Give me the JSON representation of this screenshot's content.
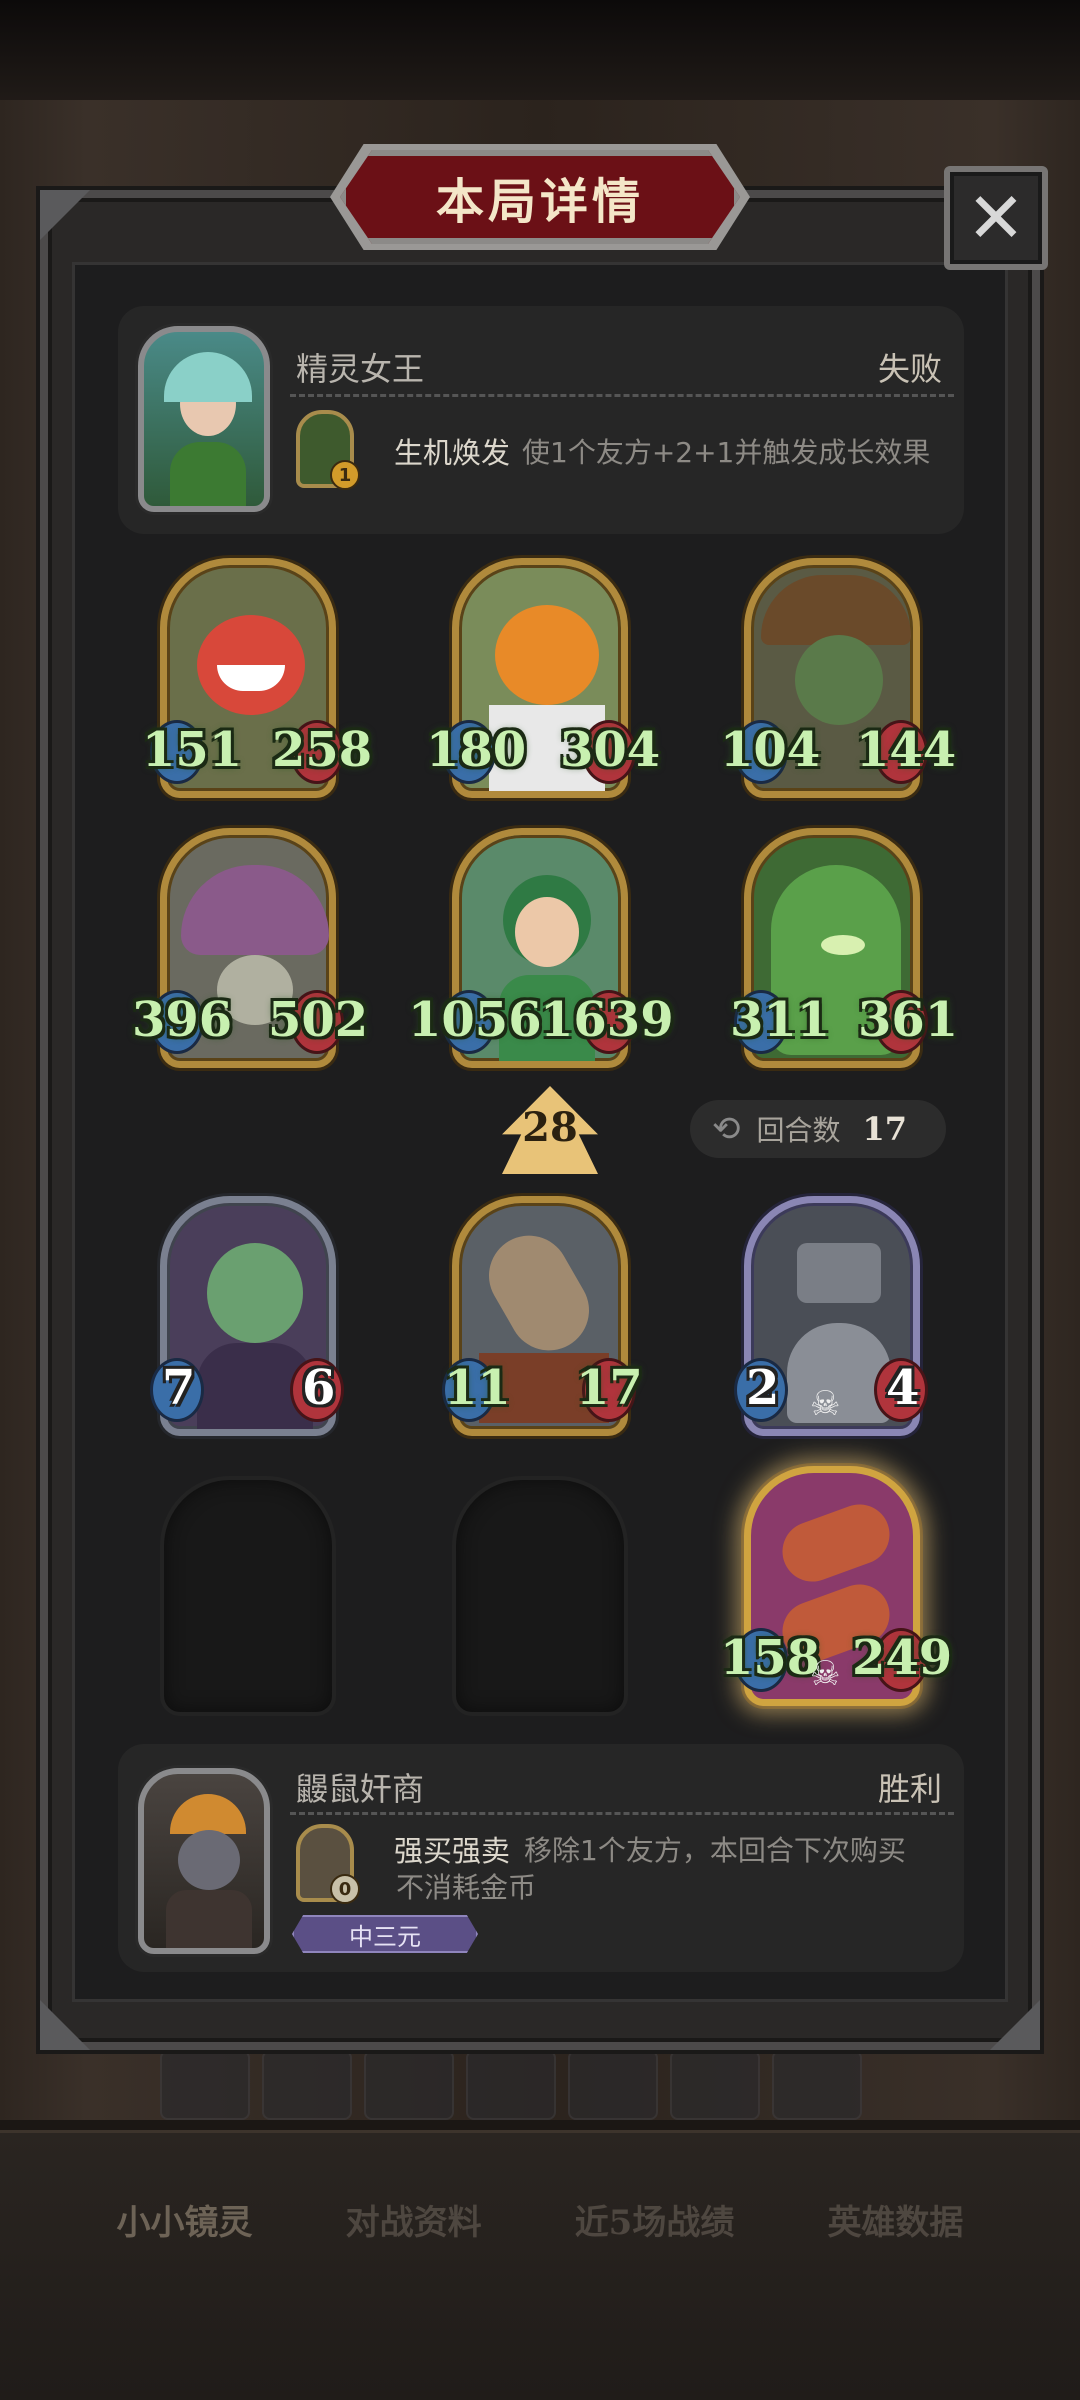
{
  "dialog": {
    "title": "本局详情",
    "close_label": "✕"
  },
  "player_top": {
    "name": "精灵女王",
    "result": "失败",
    "skill": {
      "name": "生机焕发",
      "description": "使1个友方+2+1并触发成长效果",
      "cost": "1"
    }
  },
  "enemy_board": [
    {
      "attack": "151",
      "health": "258",
      "frame": "gold"
    },
    {
      "attack": "180",
      "health": "304",
      "frame": "gold"
    },
    {
      "attack": "104",
      "health": "144",
      "frame": "gold"
    },
    {
      "attack": "396",
      "health": "502",
      "frame": "gold"
    },
    {
      "attack": "1056",
      "health": "1639",
      "frame": "gold"
    },
    {
      "attack": "311",
      "health": "361",
      "frame": "gold"
    }
  ],
  "tavern_level": "28",
  "round": {
    "label": "回合数",
    "value": "17"
  },
  "player_board": [
    {
      "attack": "7",
      "health": "6",
      "frame": "silver"
    },
    {
      "attack": "11",
      "health": "17",
      "frame": "gold"
    },
    {
      "attack": "2",
      "health": "4",
      "frame": "purple"
    },
    {
      "empty": true
    },
    {
      "empty": true
    },
    {
      "attack": "158",
      "health": "249",
      "frame": "gold-glow"
    }
  ],
  "player_bottom": {
    "name": "鼹鼠奸商",
    "result": "胜利",
    "skill": {
      "name": "强买强卖",
      "description_line1": "移除1个友方，本回合下次购买",
      "description_line2": "不消耗金币",
      "cost": "0"
    },
    "tag": "中三元"
  },
  "bottom_tabs": [
    "小小镜灵",
    "对战资料",
    "近5场战绩",
    "英雄数据"
  ],
  "colors": {
    "stat_green": "#c8f0b0",
    "dialog_title_red": "#6b1016",
    "gold_frame": "#b08a3c"
  }
}
